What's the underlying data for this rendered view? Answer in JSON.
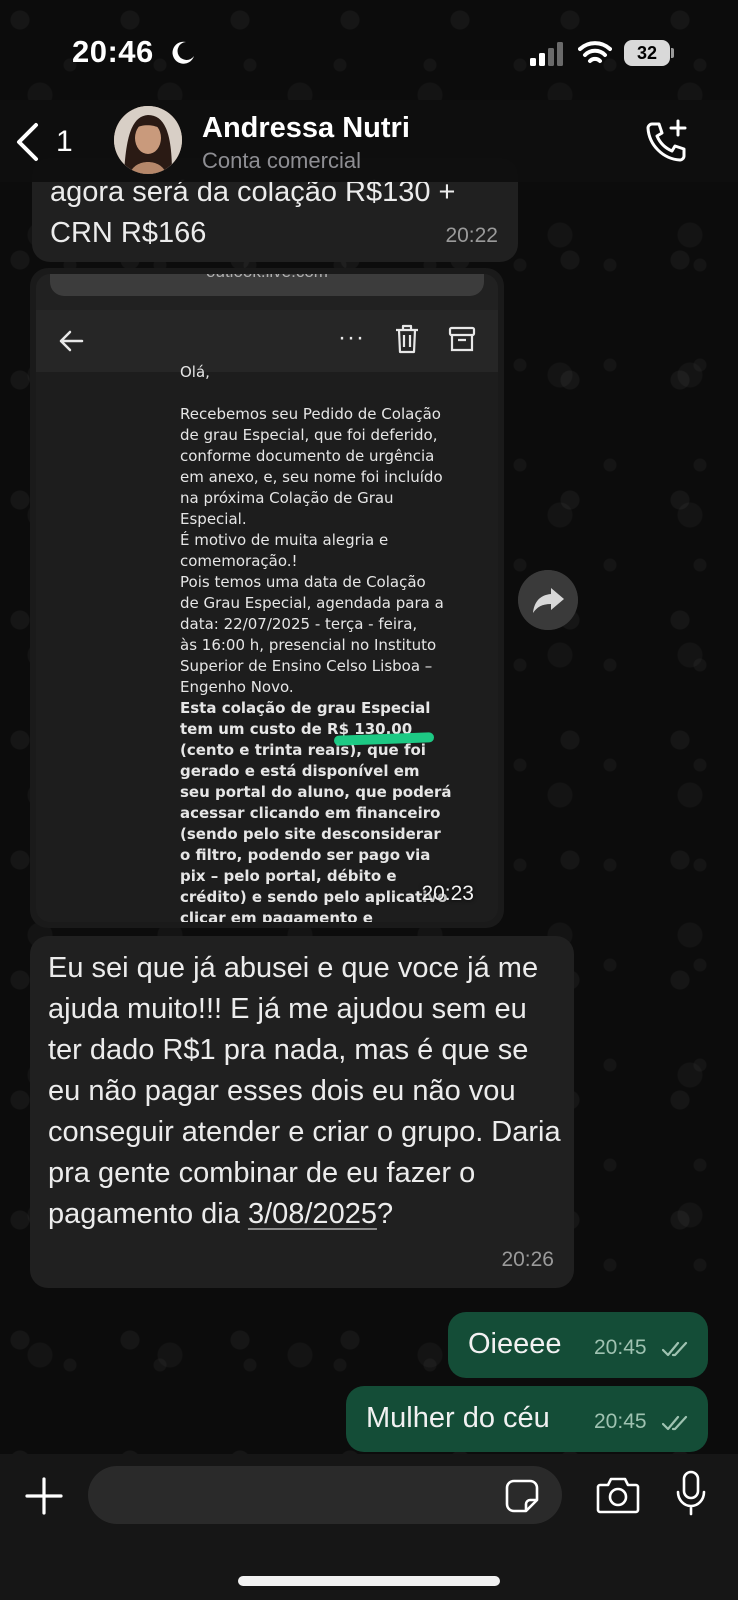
{
  "status_bar": {
    "time": "20:46",
    "battery": "32",
    "icons": [
      "moon-icon",
      "signal-icon",
      "wifi-icon",
      "battery-icon"
    ]
  },
  "header": {
    "back_count": "1",
    "contact_name": "Andressa Nutri",
    "contact_subtitle": "Conta comercial",
    "icons": [
      "back-chevron-icon",
      "avatar",
      "add-call-icon"
    ]
  },
  "messages": [
    {
      "type": "received",
      "text": "agora será da colação R$130 +\nCRN R$166",
      "time": "20:22"
    },
    {
      "type": "received-image",
      "url_text": "outlook.live.com",
      "email_greeting": "Olá,",
      "email_paragraph": "Recebemos seu Pedido de Colação\nde grau Especial, que foi deferido,\nconforme documento de urgência\nem anexo, e, seu nome foi incluído\nna próxima Colação de Grau\nEspecial.\nÉ motivo de muita alegria e\ncomemoração.!\nPois temos uma data de Colação\nde Grau Especial, agendada para a\ndata: 22/07/2025 - terça -  feira,\nàs 16:00 h, presencial no Instituto\nSuperior de Ensino Celso Lisboa –\nEngenho Novo.",
      "email_bold": "Esta colação de grau Especial\ntem um custo de R$ 130.00\n(cento e trinta reais), que foi\ngerado e está disponível em\nseu portal do aluno, que poderá\nacessar clicando em financeiro\n(sendo pelo site desconsiderar\no filtro, podendo ser pago via\npix – pelo portal, débito e\ncrédito) e sendo pelo aplicativo\nclicar em pagamento e",
      "time": "20:23"
    },
    {
      "type": "received",
      "text_before": "Eu sei que já abusei e que voce já me ajuda muito!!! E já me ajudou sem eu ter dado R$1 pra nada, mas é que se eu não pagar esses dois eu não vou conseguir atender e criar o grupo. Daria pra gente combinar de eu fazer o pagamento dia ",
      "text_link": "3/08/2025",
      "text_after": "?",
      "time": "20:26"
    },
    {
      "type": "sent",
      "text": "Oieeee",
      "time": "20:45"
    },
    {
      "type": "sent",
      "text": "Mulher do céu",
      "time": "20:45"
    }
  ],
  "input": {
    "value": "",
    "placeholder": ""
  },
  "colors": {
    "received_bubble": "#202020",
    "sent_bubble": "#144d37",
    "highlight": "#1ed38a"
  }
}
